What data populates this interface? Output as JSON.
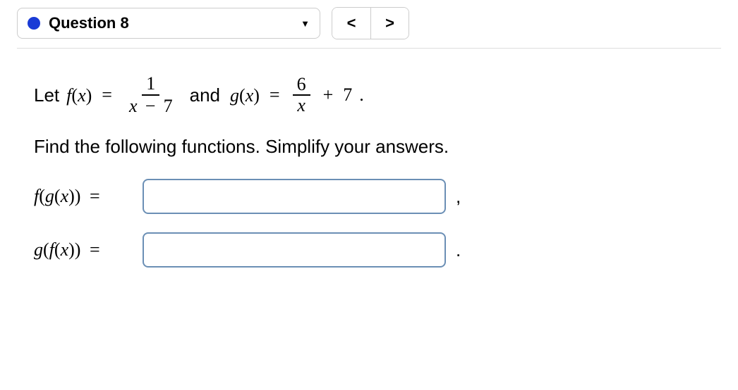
{
  "toolbar": {
    "question_label": "Question 8",
    "prev_glyph": "<",
    "next_glyph": ">"
  },
  "problem": {
    "let_text": "Let",
    "f_label": "f",
    "g_label": "g",
    "var": "x",
    "eq": "=",
    "and_text": "and",
    "f_num": "1",
    "f_den_left": "x",
    "f_den_op": "−",
    "f_den_right": "7",
    "g_num": "6",
    "g_den": "x",
    "g_plus": "+",
    "g_const": "7",
    "period": "."
  },
  "instruction": "Find the following functions. Simplify your answers.",
  "answers": {
    "fg_label_outer": "f",
    "fg_label_inner": "g",
    "gf_label_outer": "g",
    "gf_label_inner": "f",
    "var": "x",
    "eq": "=",
    "trail1": ",",
    "trail2": "."
  }
}
